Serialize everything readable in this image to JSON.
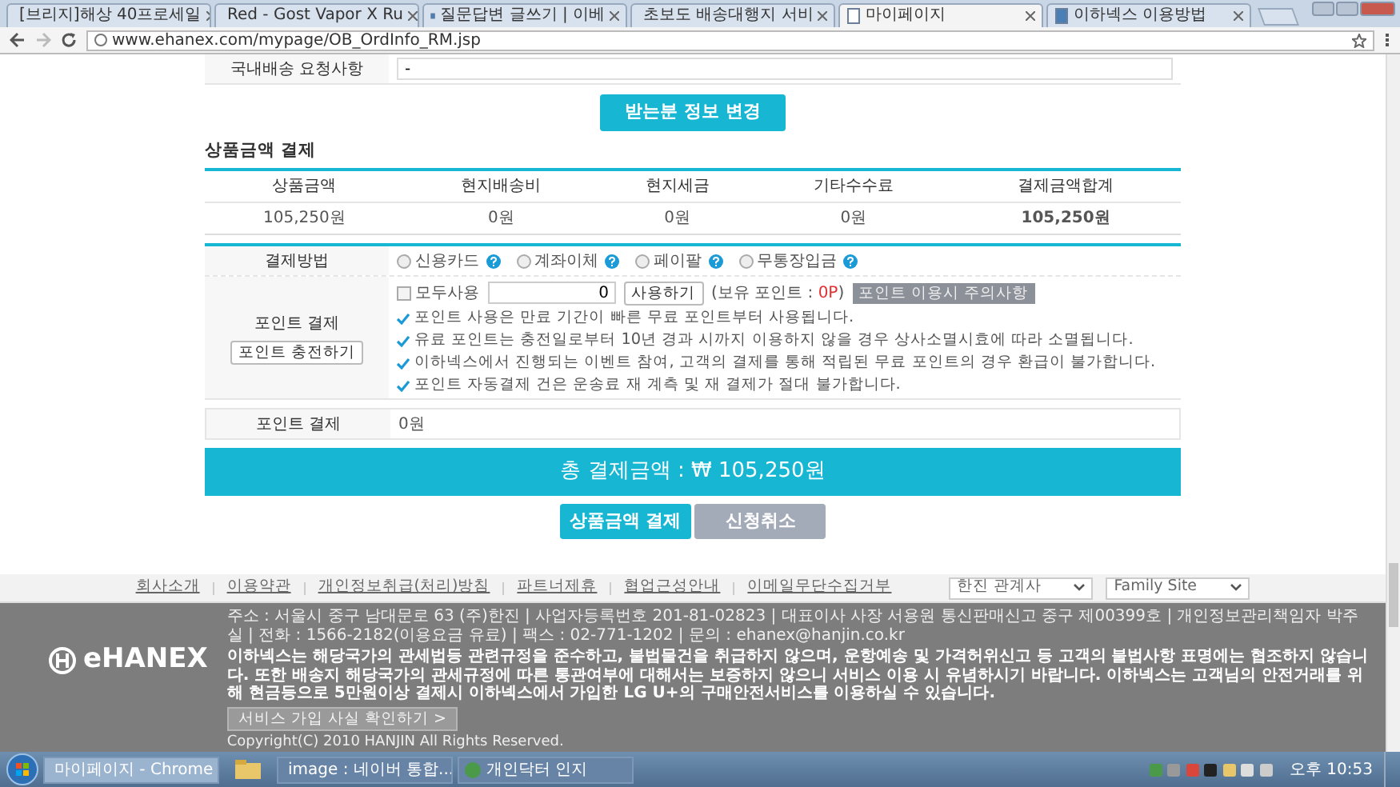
{
  "browser": {
    "tabs": [
      {
        "title": "[브리지]해상 40프로세일",
        "selected": false
      },
      {
        "title": "Red - Gost Vapor X Ru",
        "selected": false
      },
      {
        "title": "질문답변 글쓰기 | 이베",
        "selected": false
      },
      {
        "title": "초보도 배송대행지 서비",
        "selected": false
      },
      {
        "title": "마이페이지",
        "selected": true
      },
      {
        "title": "이하넥스 이용방법",
        "selected": false
      }
    ],
    "url": "www.ehanex.com/mypage/OB_OrdInfo_RM.jsp"
  },
  "request_row": {
    "label": "국내배송 요청사항",
    "value": "-"
  },
  "change_button": "받는분 정보 변경",
  "section_title": "상품금액 결제",
  "amount_table": {
    "columns": [
      "상품금액",
      "현지배송비",
      "현지세금",
      "기타수수료",
      "결제금액합계"
    ],
    "rows": [
      [
        "105,250원",
        "0원",
        "0원",
        "0원",
        "105,250원"
      ]
    ]
  },
  "payment_method": {
    "label": "결제방법",
    "options": [
      {
        "label": "신용카드",
        "selected": false
      },
      {
        "label": "계좌이체",
        "selected": false
      },
      {
        "label": "페이팔",
        "selected": false
      },
      {
        "label": "무통장입금",
        "selected": false
      }
    ]
  },
  "points": {
    "label": "포인트 결제",
    "charge_button": "포인트 충전하기",
    "use_all": {
      "label": "모두사용",
      "checked": false
    },
    "amount": "0",
    "use_button": "사용하기",
    "balance_open": "(보유 포인트 : ",
    "balance": "0P",
    "balance_close": ")",
    "notice_button": "포인트 이용시 주의사항",
    "notes": [
      "포인트 사용은 만료 기간이 빠른 무료 포인트부터 사용됩니다.",
      "유료 포인트는 충전일로부터 10년 경과 시까지 이용하지 않을 경우 상사소멸시효에 따라 소멸됩니다.",
      "이하넥스에서 진행되는 이벤트 참여, 고객의 결제를 통해 적립된 무료 포인트의 경우 환급이 불가합니다.",
      "포인트 자동결제 건은 운송료 재 계측 및 재 결제가 절대 불가합니다."
    ]
  },
  "point_total": {
    "label": "포인트 결제",
    "value": "0원"
  },
  "total": "총 결제금액 : ₩ 105,250원",
  "buttons": [
    {
      "label": "상품금액 결제",
      "kind": "primary"
    },
    {
      "label": "신청취소",
      "kind": "secondary"
    }
  ],
  "footer": {
    "links": [
      "회사소개",
      "이용약관",
      "개인정보취급(처리)방침",
      "파트너제휴",
      "협업근성안내",
      "이메일무단수집거부"
    ],
    "selects": [
      "한진 관계사",
      "Family Site"
    ],
    "logo": "eHANEX",
    "address": "주소 : 서울시 중구 남대문로 63 (주)한진 | 사업자등록번호 201-81-02823 | 대표이사 사장 서용원 통신판매신고 중구 제00399호 | 개인정보관리책임자 박주실 | 전화 : 1566-2182(이용요금 유료) | 팩스 : 02-771-1202 | 문의 : ehanex@hanjin.co.kr",
    "notice": "이하넥스는 해당국가의 관세법등 관련규정을 준수하고, 불법물건을 취급하지 않으며, 운항예송 및 가격허위신고 등 고객의 불법사항 표명에는 협조하지 않습니다. 또한 배송지 해당국가의 관세규정에 따른 통관여부에 대해서는 보증하지 않으니 서비스 이용 시 유념하시기 바랍니다. 이하넥스는 고객님의 안전거래를 위해 현금등으로 5만원이상 결제시 이하넥스에서 가입한 LG U+의 구매안전서비스를 이용하실 수 있습니다.",
    "verify_button": "서비스 가입 사실 확인하기 >",
    "copyright": "Copyright(C) 2010 HANJIN All Rights Reserved."
  },
  "taskbar": {
    "items": [
      {
        "label": "마이페이지 - Chrome",
        "selected": true
      },
      {
        "label": "image : 네이버 통합...",
        "selected": false
      },
      {
        "label": "개인닥터 인지",
        "selected": false
      }
    ],
    "clock": "오후 10:53"
  }
}
